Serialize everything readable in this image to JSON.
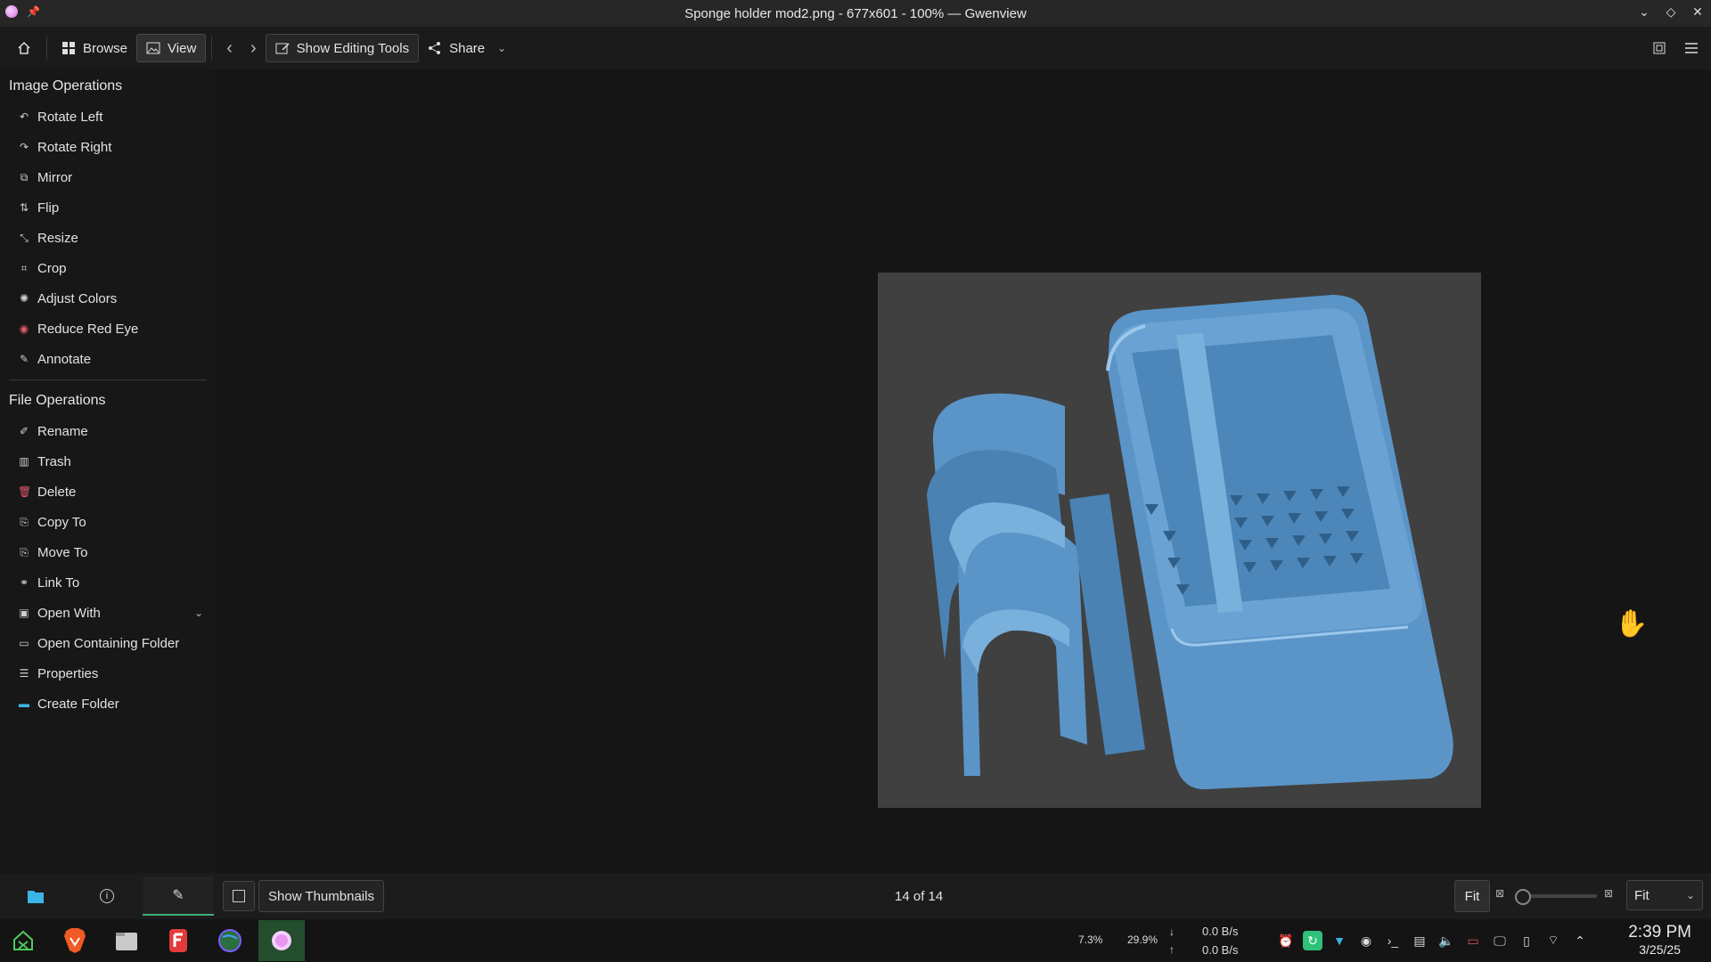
{
  "window": {
    "title": "Sponge holder mod2.png - 677x601 - 100% — Gwenview"
  },
  "toolbar": {
    "browse_label": "Browse",
    "view_label": "View",
    "editing_tools_label": "Show Editing Tools",
    "share_label": "Share"
  },
  "sidebar": {
    "image_ops_title": "Image Operations",
    "image_ops": [
      {
        "label": "Rotate Left",
        "icon": "rotate-left-icon"
      },
      {
        "label": "Rotate Right",
        "icon": "rotate-right-icon"
      },
      {
        "label": "Mirror",
        "icon": "mirror-icon"
      },
      {
        "label": "Flip",
        "icon": "flip-icon"
      },
      {
        "label": "Resize",
        "icon": "resize-icon"
      },
      {
        "label": "Crop",
        "icon": "crop-icon"
      },
      {
        "label": "Adjust Colors",
        "icon": "adjust-colors-icon"
      },
      {
        "label": "Reduce Red Eye",
        "icon": "red-eye-icon"
      },
      {
        "label": "Annotate",
        "icon": "annotate-icon"
      }
    ],
    "file_ops_title": "File Operations",
    "file_ops": [
      {
        "label": "Rename",
        "icon": "rename-icon"
      },
      {
        "label": "Trash",
        "icon": "trash-icon"
      },
      {
        "label": "Delete",
        "icon": "delete-icon"
      },
      {
        "label": "Copy To",
        "icon": "copy-icon"
      },
      {
        "label": "Move To",
        "icon": "move-icon"
      },
      {
        "label": "Link To",
        "icon": "link-icon"
      },
      {
        "label": "Open With",
        "icon": "open-with-icon"
      },
      {
        "label": "Open Containing Folder",
        "icon": "folder-open-icon"
      },
      {
        "label": "Properties",
        "icon": "properties-icon"
      },
      {
        "label": "Create Folder",
        "icon": "create-folder-icon"
      }
    ]
  },
  "statusbar": {
    "thumbnails_label": "Show Thumbnails",
    "page_position": "14 of 14",
    "fit_label": "Fit",
    "zoom_mode": "Fit"
  },
  "taskbar": {
    "cpu": "7.3%",
    "mem": "29.9%",
    "net_down": "0.0 B/s",
    "net_up": "0.0 B/s",
    "time": "2:39 PM",
    "date": "3/25/25"
  },
  "colors": {
    "accent": "#3fae78",
    "model_blue": "#5b95c8",
    "image_bg": "#404040"
  }
}
